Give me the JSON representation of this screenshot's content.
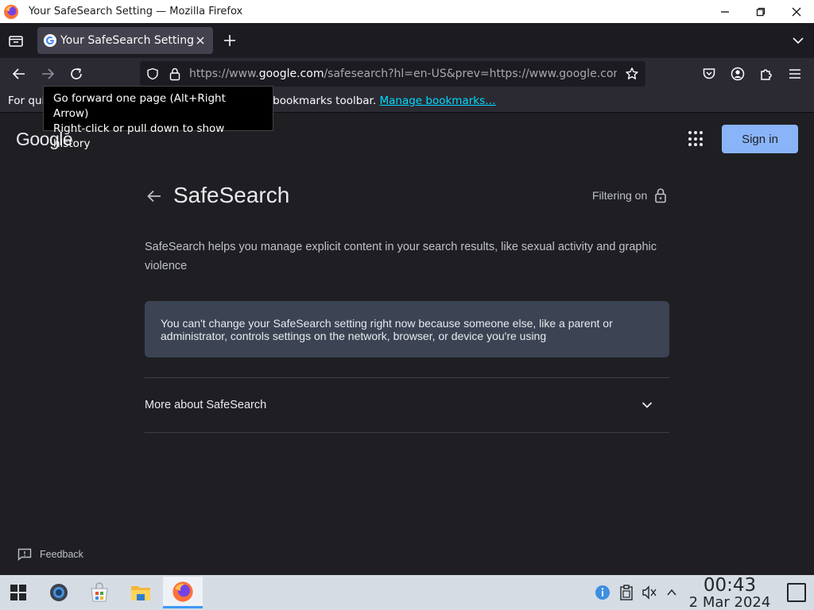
{
  "window": {
    "title": "Your SafeSearch Setting — Mozilla Firefox"
  },
  "tabs": [
    {
      "label": "Your SafeSearch Setting"
    }
  ],
  "urlbar": {
    "url_prefix": "https://www.",
    "url_domain": "google.com",
    "url_suffix": "/safesearch?hl=en-US&prev=https://www.google.com/"
  },
  "bookmarks_bar": {
    "text_start": "For quic",
    "text_end": "the bookmarks toolbar. ",
    "link": "Manage bookmarks…"
  },
  "tooltip": {
    "line1": "Go forward one page (Alt+Right Arrow)",
    "line2": "Right-click or pull down to show history"
  },
  "page": {
    "logo": "Google",
    "sign_in": "Sign in",
    "heading": "SafeSearch",
    "filter_status": "Filtering on",
    "description": "SafeSearch helps you manage explicit content in your search results, like sexual activity and graphic violence",
    "notice": "You can't change your SafeSearch setting right now because someone else, like a parent or administrator, controls settings on the network, browser, or device you're using",
    "more_label": "More about SafeSearch",
    "feedback": "Feedback"
  },
  "taskbar": {
    "time": "00:43",
    "date": "2 Mar 2024"
  },
  "colors": {
    "page_bg": "#1f1f23",
    "accent": "#8ab4f8",
    "notice_bg": "#3c4454",
    "link": "#00ddff"
  },
  "icons": {
    "window": [
      "firefox-icon",
      "minimize-icon",
      "maximize-icon",
      "close-icon"
    ],
    "toolbar": [
      "back-icon",
      "forward-icon",
      "reload-icon",
      "shield-icon",
      "lock-icon",
      "star-icon",
      "pocket-icon",
      "account-icon",
      "extensions-icon",
      "hamburger-menu-icon"
    ],
    "tray": [
      "info-icon",
      "clipboard-icon",
      "volume-muted-icon",
      "chevron-up-icon"
    ]
  }
}
